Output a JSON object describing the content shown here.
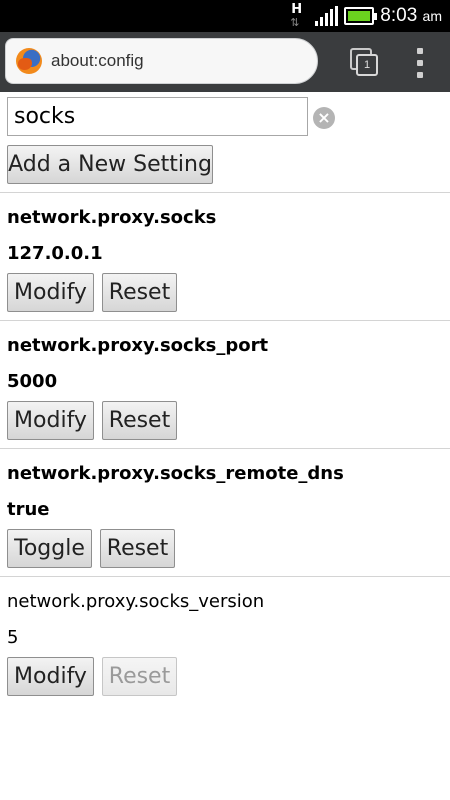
{
  "status_bar": {
    "network_icon": "h-plus-data-icon",
    "network_letter": "H",
    "signal_bars": 4,
    "battery_level": 1.0,
    "time": "8:03",
    "ampm": "am"
  },
  "toolbar": {
    "url": "about:config",
    "tab_count": "1",
    "browser_icon": "firefox-logo"
  },
  "search": {
    "value": "socks",
    "placeholder": ""
  },
  "add_button": "Add a New Setting",
  "prefs": [
    {
      "name": "network.proxy.socks",
      "value": "127.0.0.1",
      "modified": true,
      "primary": "Modify",
      "reset": "Reset",
      "reset_enabled": true
    },
    {
      "name": "network.proxy.socks_port",
      "value": "5000",
      "modified": true,
      "primary": "Modify",
      "reset": "Reset",
      "reset_enabled": true
    },
    {
      "name": "network.proxy.socks_remote_dns",
      "value": "true",
      "modified": true,
      "primary": "Toggle",
      "reset": "Reset",
      "reset_enabled": true
    },
    {
      "name": "network.proxy.socks_version",
      "value": "5",
      "modified": false,
      "primary": "Modify",
      "reset": "Reset",
      "reset_enabled": false
    }
  ]
}
